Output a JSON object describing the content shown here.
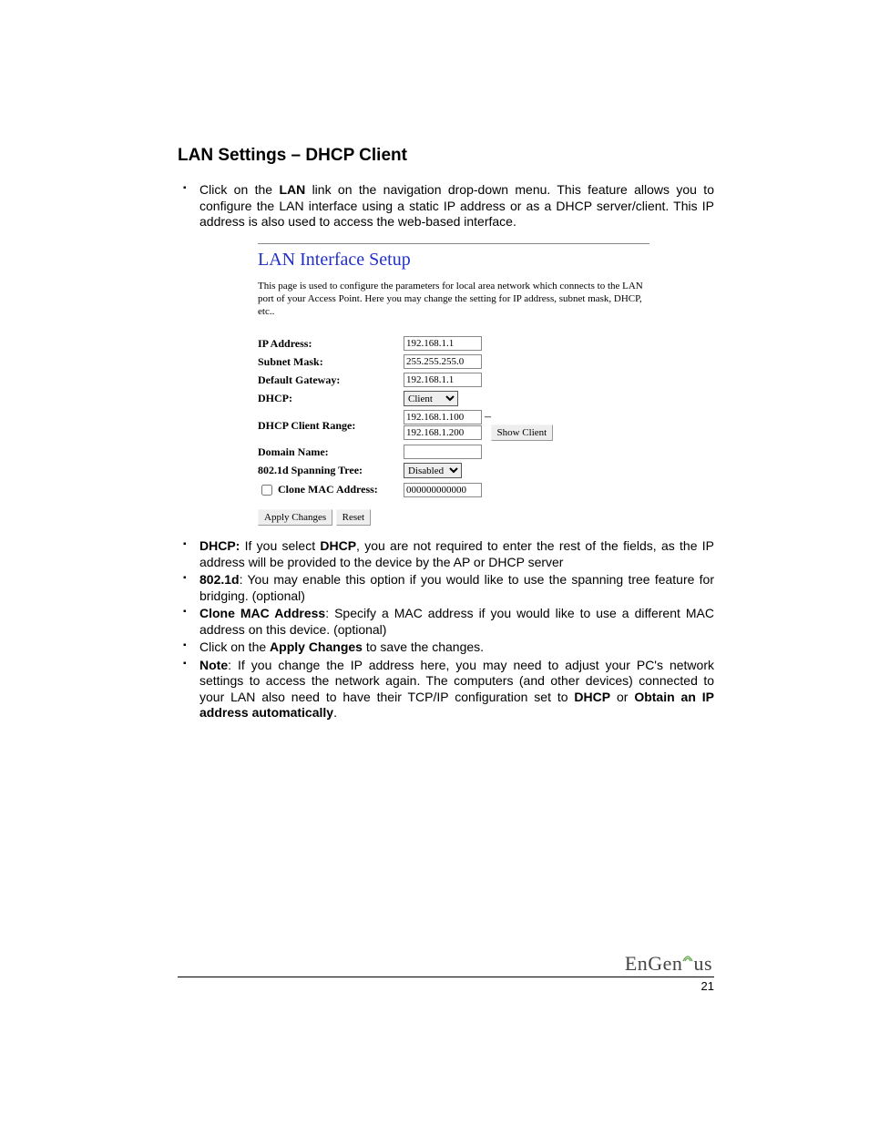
{
  "title": "LAN Settings – DHCP Client",
  "intro_pre": "Click on the ",
  "intro_link": "LAN",
  "intro_post": " link on the navigation drop-down menu. This feature allows you to configure the LAN interface using a static IP address or as a DHCP server/client. This IP address is also used to access the web-based interface.",
  "panel": {
    "title": "LAN Interface Setup",
    "desc": "This page is used to configure the parameters for local area network which connects to the LAN port of your Access Point. Here you may change the setting for IP address, subnet mask, DHCP, etc..",
    "labels": {
      "ip": "IP Address:",
      "mask": "Subnet Mask:",
      "gw": "Default Gateway:",
      "dhcp": "DHCP:",
      "range": "DHCP Client Range:",
      "domain": "Domain Name:",
      "stp": "802.1d Spanning Tree:",
      "clone": "Clone MAC Address:"
    },
    "values": {
      "ip": "192.168.1.1",
      "mask": "255.255.255.0",
      "gw": "192.168.1.1",
      "dhcp": "Client",
      "range_from": "192.168.1.100",
      "range_to": "192.168.1.200",
      "domain": "",
      "stp": "Disabled",
      "clone": "000000000000"
    },
    "buttons": {
      "show_client": "Show Client",
      "apply": "Apply Changes",
      "reset": "Reset"
    }
  },
  "bullets": {
    "dhcp_head": "DHCP:",
    "dhcp_mid": " If you select ",
    "dhcp_key": "DHCP",
    "dhcp_tail": ", you are not required to enter the rest of the fields, as the IP address will be provided to the device by the AP or DHCP server",
    "d8021_head": "802.1d",
    "d8021_tail": ": You may enable this option if you would like to use the spanning tree feature for bridging. (optional)",
    "clone_head": "Clone MAC Address",
    "clone_tail": ": Specify a MAC address if you would like to use a different MAC address on this device. (optional)",
    "apply_pre": "Click on the ",
    "apply_key": "Apply Changes",
    "apply_post": " to save the changes.",
    "note_head": "Note",
    "note_mid": ": If you change the IP address here, you  may need to adjust your PC's network settings to access the network again. The computers (and other devices) connected to your LAN also need to have their TCP/IP configuration set to ",
    "note_k1": "DHCP",
    "note_or": " or ",
    "note_k2": "Obtain an IP address automatically",
    "note_end": "."
  },
  "footer": {
    "brand": "EnGenius",
    "page": "21"
  }
}
